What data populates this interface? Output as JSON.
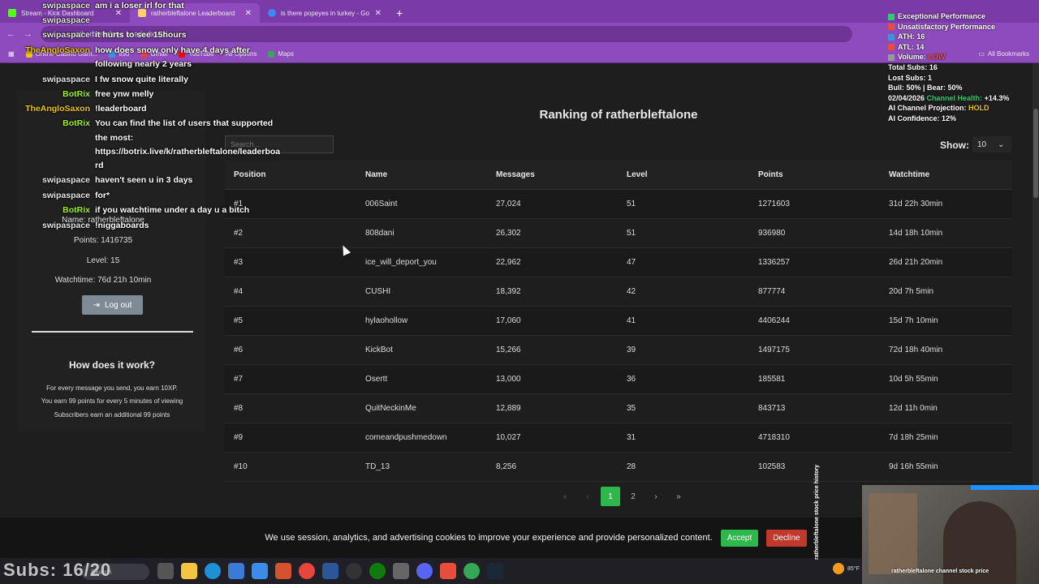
{
  "browser": {
    "tabs": [
      {
        "label": "Stream - Kick Dashboard",
        "color": "#53fc18"
      },
      {
        "label": "ratherbleftalone Leaderboard",
        "color": "#ffd166"
      },
      {
        "label": "is there popeyes in turkey - Go",
        "color": "#4285f4"
      }
    ],
    "new_tab": "+",
    "url": "ratherbleftalone Leaderboard",
    "bookmarks": [
      "Online Casino Gam...",
      "990",
      "Gmail",
      "YouTube",
      "All Options",
      "Maps"
    ],
    "all_bookmarks": "All Bookmarks"
  },
  "sidebar": {
    "name": "Name: ratherbleftalone",
    "points": "Points: 1416735",
    "level": "Level: 15",
    "watchtime": "Watchtime: 76d 21h 10min",
    "logout": "Log out",
    "how_title": "How does it work?",
    "how_lines": [
      "For every message you send, you earn 10XP.",
      "You earn 99 points for every 5 minutes of viewing",
      "Subscribers earn an additional 99 points"
    ]
  },
  "search": {
    "placeholder": "Search..."
  },
  "ranking_title": "Ranking of ratherbleftalone",
  "show": {
    "label": "Show:",
    "value": "10"
  },
  "table": {
    "headers": [
      "Position",
      "Name",
      "Messages",
      "Level",
      "Points",
      "Watchtime"
    ],
    "rows": [
      [
        "#1",
        "006Saint",
        "27,024",
        "51",
        "1271603",
        "31d 22h 30min"
      ],
      [
        "#2",
        "808dani",
        "26,302",
        "51",
        "936980",
        "14d 18h 10min"
      ],
      [
        "#3",
        "ice_will_deport_you",
        "22,962",
        "47",
        "1336257",
        "26d 21h 20min"
      ],
      [
        "#4",
        "CUSHI",
        "18,392",
        "42",
        "877774",
        "20d 7h 5min"
      ],
      [
        "#5",
        "hylaohollow",
        "17,060",
        "41",
        "4406244",
        "15d 7h 10min"
      ],
      [
        "#6",
        "KickBot",
        "15,266",
        "39",
        "1497175",
        "72d 18h 40min"
      ],
      [
        "#7",
        "Osertt",
        "13,000",
        "36",
        "185581",
        "10d 5h 55min"
      ],
      [
        "#8",
        "QuitNeckinMe",
        "12,889",
        "35",
        "843713",
        "12d 11h 0min"
      ],
      [
        "#9",
        "comeandpushmedown",
        "10,027",
        "31",
        "4718310",
        "7d 18h 25min"
      ],
      [
        "#10",
        "TD_13",
        "8,256",
        "28",
        "102583",
        "9d 16h 55min"
      ]
    ]
  },
  "pager": {
    "first": "«",
    "prev": "‹",
    "pages": [
      "1",
      "2"
    ],
    "next": "›",
    "last": "»"
  },
  "cookie": {
    "text": "We use session, analytics, and advertising cookies to improve your experience and provide personalized content.",
    "accept": "Accept",
    "decline": "Decline"
  },
  "chat": [
    {
      "user": "swipaspace",
      "color": "#e6e6e6",
      "text": "am i a loser irl for that"
    },
    {
      "user": "swipaspace",
      "color": "#e6e6e6",
      "text": ""
    },
    {
      "user": "swipaspace",
      "color": "#e6e6e6",
      "text": "it hurts to see 15hours"
    },
    {
      "user": "TheAngloSaxon",
      "color": "#f1c40f",
      "text": "how does snow only have 4 days after"
    },
    {
      "user": "",
      "color": "#ffffff",
      "text": "following nearly 2 years"
    },
    {
      "user": "swipaspace",
      "color": "#e6e6e6",
      "text": "I fw snow quite literally"
    },
    {
      "user": "BotRix",
      "color": "#9ef01a",
      "text": "free ynw melly"
    },
    {
      "user": "TheAngloSaxon",
      "color": "#f1c40f",
      "text": "!leaderboard"
    },
    {
      "user": "BotRix",
      "color": "#9ef01a",
      "text": "You can find the list of users that supported"
    },
    {
      "user": "",
      "color": "#ffffff",
      "text": "the most:"
    },
    {
      "user": "",
      "color": "#ffffff",
      "text": "https://botrix.live/k/ratherbleftalone/leaderboa"
    },
    {
      "user": "",
      "color": "#ffffff",
      "text": "rd"
    },
    {
      "user": "swipaspace",
      "color": "#e6e6e6",
      "text": "haven't seen u in 3 days"
    },
    {
      "user": "swipaspace",
      "color": "#e6e6e6",
      "text": "for*"
    },
    {
      "user": "BotRix",
      "color": "#9ef01a",
      "text": "if you watchtime under a day u a bitch"
    },
    {
      "user": "swipaspace",
      "color": "#e6e6e6",
      "text": "!niggaboards"
    }
  ],
  "stats": {
    "exceptional": "Exceptional Performance",
    "unsatisfactory": "Unsatisfactory Performance",
    "ath": "ATH: 16",
    "atl": "ATL: 14",
    "volume_label": "Volume: ",
    "volume_value": "LOW",
    "total_subs": "Total Subs: 16",
    "lost_subs": "Lost Subs: 1",
    "bull_bear": "Bull: 50% | Bear: 50%",
    "date": "02/04/2026 ",
    "health_label": "Channel Health: ",
    "health_value": "+14.3%",
    "projection_label": "AI Channel Projection: ",
    "projection_value": "HOLD",
    "confidence": "AI Confidence: 12%",
    "colors": {
      "exceptional": "#2ecc71",
      "unsatisfactory": "#e74c3c",
      "ath": "#3498db",
      "atl": "#e74c3c",
      "health": "#2ecc71",
      "hold": "#f1c40f",
      "low": "#e74c3c"
    }
  },
  "overlay": {
    "subs": "Subs: 16/20",
    "cam_caption": "ratherbleftalone channel stock price",
    "vertical_label": "ratherbleftalone stock price history",
    "weather": "85°F"
  },
  "taskbar": {
    "search_placeholder": "Search"
  }
}
